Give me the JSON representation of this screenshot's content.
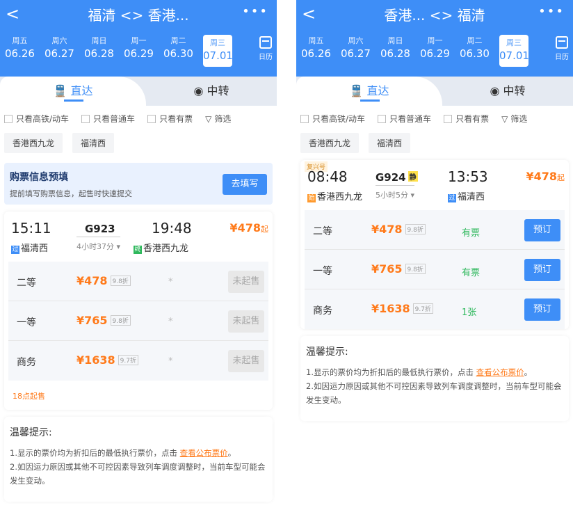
{
  "left": {
    "title": "福清 <> 香港...",
    "back": "<",
    "more": "•••",
    "dates": [
      {
        "wd": "周五",
        "d": "06.26"
      },
      {
        "wd": "周六",
        "d": "06.27"
      },
      {
        "wd": "周日",
        "d": "06.28"
      },
      {
        "wd": "周一",
        "d": "06.29"
      },
      {
        "wd": "周二",
        "d": "06.30"
      },
      {
        "wd": "周三",
        "d": "07.01"
      }
    ],
    "calendar": "日历",
    "tab_direct": "直达",
    "tab_transfer": "中转",
    "filters": [
      "只看高铁/动车",
      "只看普通车",
      "只看有票"
    ],
    "filter_btn": "筛选",
    "stations": [
      "香港西九龙",
      "福清西"
    ],
    "banner_title": "购票信息预填",
    "banner_sub": "提前填写购票信息，起售时快速提交",
    "banner_btn": "去填写",
    "train": {
      "dep_time": "15:11",
      "number": "G923",
      "arr_time": "19:48",
      "price": "¥478",
      "price_suffix": "起",
      "duration": "4小时37分 ▾",
      "from_mark": "过",
      "from": "福清西",
      "to_mark": "终",
      "to": "香港西九龙"
    },
    "seats": [
      {
        "name": "二等",
        "price": "¥478",
        "disc": "9.8折",
        "avail": "*",
        "btn": "未起售"
      },
      {
        "name": "一等",
        "price": "¥765",
        "disc": "9.8折",
        "avail": "*",
        "btn": "未起售"
      },
      {
        "name": "商务",
        "price": "¥1638",
        "disc": "9.7折",
        "avail": "*",
        "btn": "未起售"
      }
    ],
    "sale_note": "18点起售",
    "tips_title": "温馨提示:",
    "tip1_pre": "1.显示的票价均为折扣后的最低执行票价，点击 ",
    "tip1_link": "查看公布票价",
    "tip1_post": "。",
    "tip2": "2.如因运力原因或其他不可控因素导致列车调度调整时，当前车型可能会发生变动。"
  },
  "right": {
    "title": "香港... <> 福清",
    "back": "<",
    "more": "•••",
    "dates": [
      {
        "wd": "周五",
        "d": "06.26"
      },
      {
        "wd": "周六",
        "d": "06.27"
      },
      {
        "wd": "周日",
        "d": "06.28"
      },
      {
        "wd": "周一",
        "d": "06.29"
      },
      {
        "wd": "周二",
        "d": "06.30"
      },
      {
        "wd": "周三",
        "d": "07.01"
      }
    ],
    "calendar": "日历",
    "tab_direct": "直达",
    "tab_transfer": "中转",
    "filters": [
      "只看高铁/动车",
      "只看普通车",
      "只看有票"
    ],
    "filter_btn": "筛选",
    "stations": [
      "香港西九龙",
      "福清西"
    ],
    "train": {
      "tag": "复兴号",
      "dep_time": "08:48",
      "number": "G924",
      "badge": "静",
      "arr_time": "13:53",
      "price": "¥478",
      "price_suffix": "起",
      "duration": "5小时5分 ▾",
      "from_mark": "始",
      "from": "香港西九龙",
      "to_mark": "过",
      "to": "福清西"
    },
    "seats": [
      {
        "name": "二等",
        "price": "¥478",
        "disc": "9.8折",
        "avail": "有票",
        "btn": "预订"
      },
      {
        "name": "一等",
        "price": "¥765",
        "disc": "9.8折",
        "avail": "有票",
        "btn": "预订"
      },
      {
        "name": "商务",
        "price": "¥1638",
        "disc": "9.7折",
        "avail": "1张",
        "btn": "预订"
      }
    ],
    "tips_title": "温馨提示:",
    "tip1_pre": "1.显示的票价均为折扣后的最低执行票价，点击 ",
    "tip1_link": "查看公布票价",
    "tip1_post": "。",
    "tip2": "2.如因运力原因或其他不可控因素导致列车调度调整时，当前车型可能会发生变动。"
  },
  "colors": {
    "primary": "#3e8ef7",
    "price": "#ff7a1a",
    "available": "#2eb85c"
  }
}
